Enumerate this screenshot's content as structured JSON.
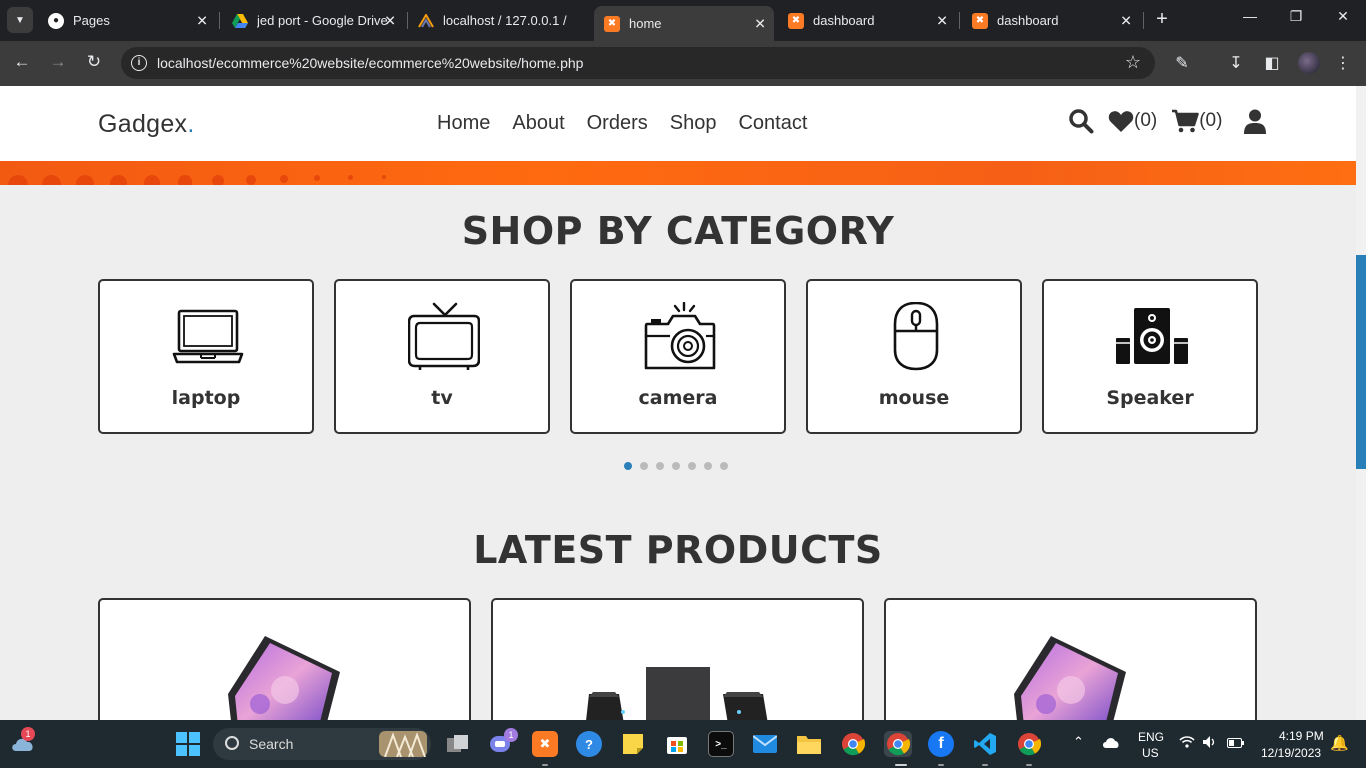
{
  "browser": {
    "tabs": [
      {
        "title": "Pages",
        "icon": "github-icon"
      },
      {
        "title": "jed port - Google Drive",
        "icon": "google-drive-icon"
      },
      {
        "title": "localhost / 127.0.0.1 / ",
        "icon": "phpmyadmin-icon"
      },
      {
        "title": "home",
        "icon": "xampp-icon",
        "active": true
      },
      {
        "title": "dashboard",
        "icon": "xampp-icon"
      },
      {
        "title": "dashboard",
        "icon": "xampp-icon"
      }
    ],
    "url": "localhost/ecommerce%20website/ecommerce%20website/home.php"
  },
  "site": {
    "logo": "Gadgex",
    "logo_dot": ".",
    "nav": [
      "Home",
      "About",
      "Orders",
      "Shop",
      "Contact"
    ],
    "wishlist_count": "(0)",
    "cart_count": "(0)",
    "accent_color": "#2980b9",
    "banner_color": "#ff6a10"
  },
  "category_section": {
    "title": "SHOP BY CATEGORY",
    "categories": [
      {
        "name": "laptop",
        "icon": "laptop-icon"
      },
      {
        "name": "tv",
        "icon": "tv-icon"
      },
      {
        "name": "camera",
        "icon": "camera-icon"
      },
      {
        "name": "mouse",
        "icon": "mouse-icon"
      },
      {
        "name": "Speaker",
        "icon": "speaker-icon"
      }
    ],
    "slider_pages": 7,
    "slider_active_page": 1
  },
  "products_section": {
    "title": "LATEST PRODUCTS",
    "products": [
      {
        "image": "laptop-product-image"
      },
      {
        "image": "pc-speakers-product-image"
      },
      {
        "image": "laptop-product-image"
      }
    ]
  },
  "taskbar": {
    "search_label": "Search",
    "weather_badge": "1",
    "teams_badge": "1",
    "language": "ENG",
    "region": "US",
    "time": "4:19 PM",
    "date": "12/19/2023"
  }
}
